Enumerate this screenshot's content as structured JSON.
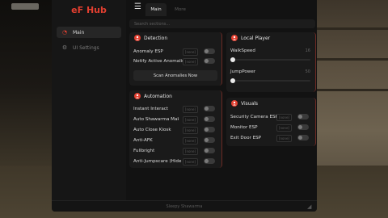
{
  "app": {
    "title": "eF Hub"
  },
  "sidebar": {
    "items": [
      {
        "label": "Main",
        "icon": "dashboard-icon",
        "active": true
      },
      {
        "label": "UI Settings",
        "icon": "gear-icon",
        "active": false
      }
    ]
  },
  "header": {
    "tabs": [
      {
        "label": "Main",
        "selected": true
      },
      {
        "label": "More",
        "selected": false
      }
    ],
    "search_placeholder": "Search sections..."
  },
  "sections": {
    "detection": {
      "title": "Detection",
      "rows": [
        {
          "label": "Anomaly ESP",
          "keybind": "[none]",
          "enabled": false
        },
        {
          "label": "Notify Active Anomalies",
          "keybind": "[none]",
          "enabled": false
        }
      ],
      "button": "Scan Anomalies Now"
    },
    "automation": {
      "title": "Automation",
      "rows": [
        {
          "label": "Instant Interact",
          "keybind": "[none]",
          "enabled": false
        },
        {
          "label": "Auto Shawarma Making",
          "keybind": "[none]",
          "enabled": false
        },
        {
          "label": "Auto Close Kiosk",
          "keybind": "[none]",
          "enabled": false
        },
        {
          "label": "Anti-AFK",
          "keybind": "[none]",
          "enabled": false
        },
        {
          "label": "Fullbright",
          "keybind": "[none]",
          "enabled": false
        },
        {
          "label": "Anti-Jumpscare (Hide Blur)",
          "keybind": "[none]",
          "enabled": false
        }
      ]
    },
    "local_player": {
      "title": "Local Player",
      "sliders": [
        {
          "label": "WalkSpeed",
          "value": "16",
          "fraction": 0.0
        },
        {
          "label": "JumpPower",
          "value": "50",
          "fraction": 0.0
        }
      ]
    },
    "visuals": {
      "title": "Visuals",
      "rows": [
        {
          "label": "Security Camera ESP",
          "keybind": "[none]",
          "enabled": false
        },
        {
          "label": "Monitor ESP",
          "keybind": "[none]",
          "enabled": false
        },
        {
          "label": "Exit Door ESP",
          "keybind": "[none]",
          "enabled": false
        }
      ]
    }
  },
  "footer": {
    "text": "Sleepy Shawarma"
  },
  "colors": {
    "accent": "#e23f30",
    "panel": "#1a1a1a",
    "window": "#141414"
  }
}
